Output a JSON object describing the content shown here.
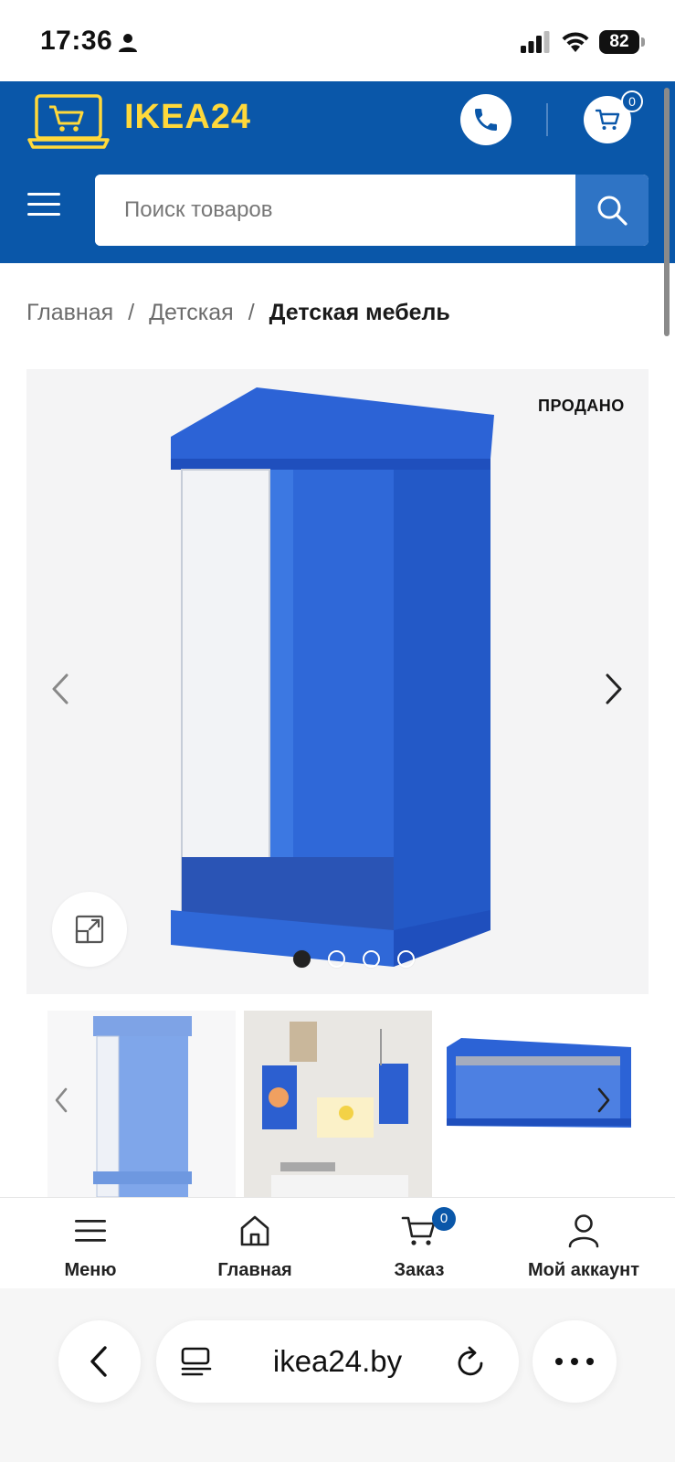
{
  "status_bar": {
    "time": "17:36",
    "battery": "82",
    "icons": [
      "person-icon",
      "signal-icon",
      "wifi-icon",
      "battery-icon"
    ]
  },
  "header": {
    "logo_text": "IKEA24",
    "brand_color": "#0a57a9",
    "logo_color": "#ffd93b",
    "cart_count": "0",
    "search": {
      "placeholder": "Поиск товаров",
      "value": ""
    }
  },
  "breadcrumb": {
    "items": [
      "Главная",
      "Детская"
    ],
    "separator": "/",
    "current": "Детская мебель"
  },
  "gallery": {
    "badge": "ПРОДАНО",
    "slide_count": 4,
    "active_slide": 1
  },
  "bottom_nav": {
    "items": [
      {
        "label": "Меню",
        "icon": "menu-icon"
      },
      {
        "label": "Главная",
        "icon": "home-icon"
      },
      {
        "label": "Заказ",
        "icon": "cart-icon",
        "badge": "0"
      },
      {
        "label": "Мой аккаунт",
        "icon": "user-icon"
      }
    ]
  },
  "browser": {
    "url": "ikea24.by"
  }
}
